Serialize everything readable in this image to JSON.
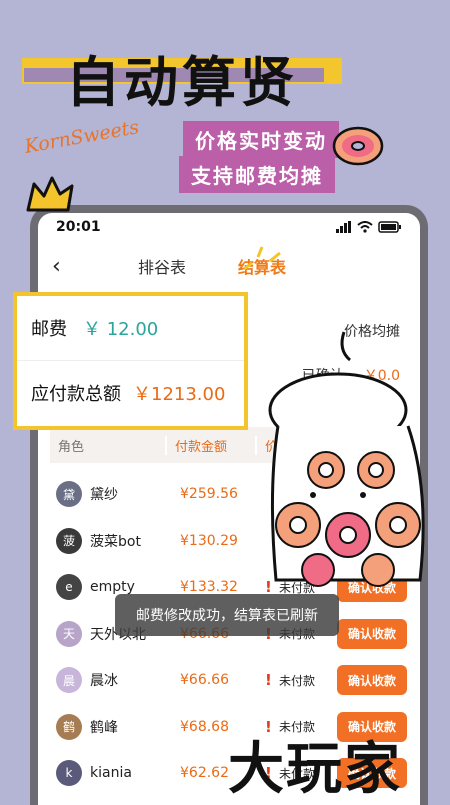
{
  "promo": {
    "title": "自动算贤",
    "brand": "KornSweets",
    "tag1": "价格实时变动",
    "tag2": "支持邮费均摊"
  },
  "status_bar": {
    "time": "20:01"
  },
  "nav": {
    "tab1": "排谷表",
    "tab2": "结算表"
  },
  "overlay": {
    "postage_label": "邮费",
    "postage_value": "￥ 12.00",
    "total_label": "应付款总额",
    "total_value": "￥1213.00"
  },
  "summary": {
    "avg_label": "价格均摊",
    "confirmed_label": "已确认",
    "confirmed_value": "￥0.0"
  },
  "table": {
    "headers": {
      "role": "角色",
      "amount": "付款金额",
      "status": "价"
    },
    "rows": [
      {
        "name": "黛纱",
        "amount": "¥259.56",
        "status": "",
        "button": ""
      },
      {
        "name": "菠菜bot",
        "amount": "¥130.29",
        "status": "",
        "button": ""
      },
      {
        "name": "empty",
        "amount": "¥133.32",
        "status": "未付款",
        "button": "确认收款"
      },
      {
        "name": "天外以北",
        "amount": "¥66.66",
        "status": "未付款",
        "button": "确认收款"
      },
      {
        "name": "晨冰",
        "amount": "¥66.66",
        "status": "未付款",
        "button": "确认收款"
      },
      {
        "name": "鹤峰",
        "amount": "¥68.68",
        "status": "未付款",
        "button": "确认收款"
      },
      {
        "name": "kiania",
        "amount": "¥62.62",
        "status": "未付款",
        "button": "确认收款"
      }
    ]
  },
  "toast": "邮费修改成功，结算表已刷新",
  "watermark": "大玩家",
  "colors": {
    "accent": "#f07a16",
    "button": "#f27025",
    "teal": "#2ba59a",
    "yellow": "#f3c42b",
    "tag": "#bb5fa9"
  }
}
